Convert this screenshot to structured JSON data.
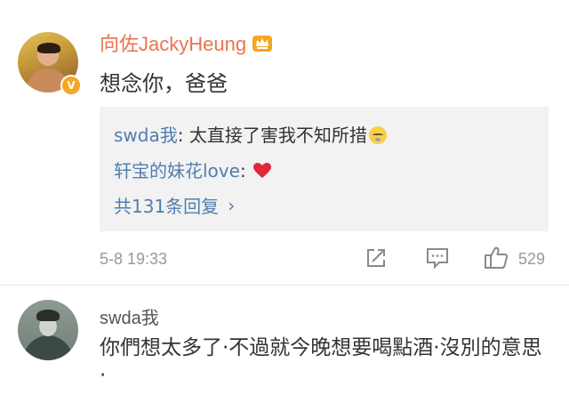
{
  "comment1": {
    "author": "向佐JackyHeung",
    "verified_badge": "V",
    "text": "想念你，爸爸",
    "replies": [
      {
        "user": "swda我",
        "separator": ": ",
        "text": "太直接了害我不知所措",
        "emoji": "sleepy-face-emoji"
      },
      {
        "user": "轩宝的妹花love",
        "separator": ": ",
        "emoji": "red-heart-emoji"
      }
    ],
    "more_replies": "共131条回复",
    "timestamp": "5-8 19:33",
    "like_count": "529"
  },
  "comment2": {
    "author": "swda我",
    "text": "你們想太多了·不過就今晚想要喝點酒·沒別的意思·"
  },
  "colors": {
    "author_orange": "#eb7350",
    "link_blue": "#507daf",
    "reply_bg": "#f2f2f2",
    "meta_gray": "#999999",
    "heart_red": "#e0283a",
    "crown_gold": "#f5a623"
  }
}
